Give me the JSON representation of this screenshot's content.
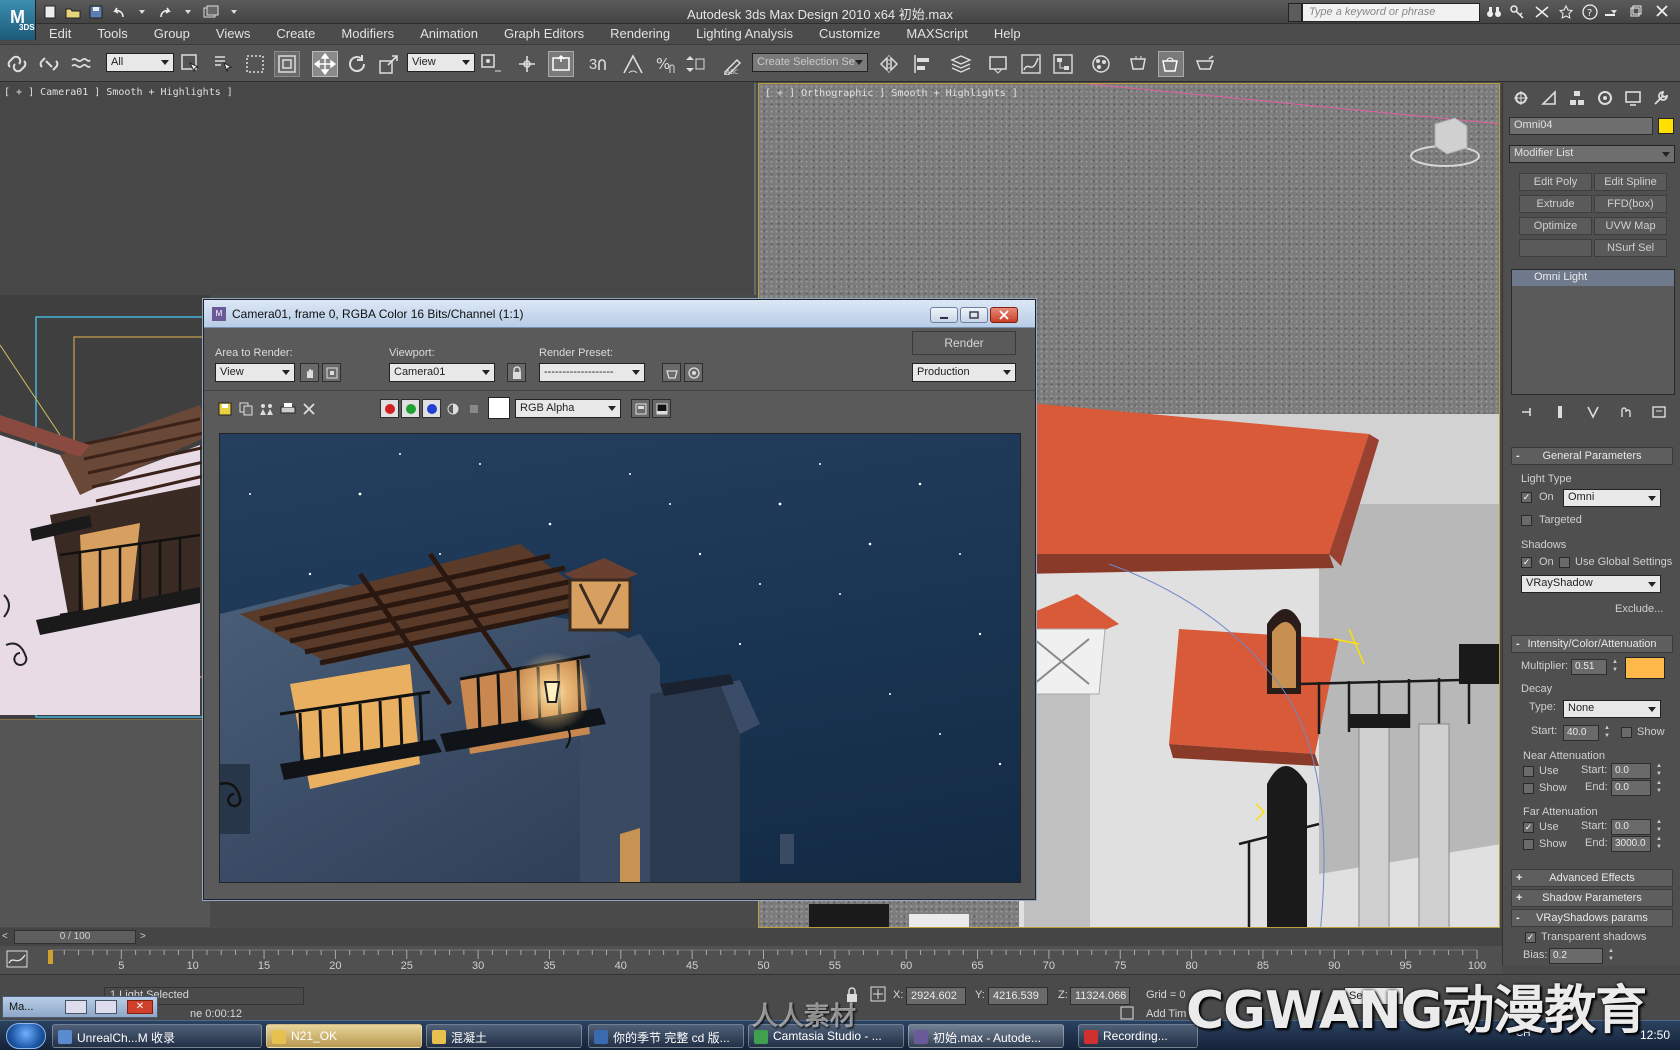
{
  "app": {
    "logo_text": "M",
    "logo_sub": "3DS",
    "window_title": "Autodesk 3ds Max Design 2010 x64       初始.max",
    "search_placeholder": "Type a keyword or phrase"
  },
  "menu": [
    "Edit",
    "Tools",
    "Group",
    "Views",
    "Create",
    "Modifiers",
    "Animation",
    "Graph Editors",
    "Rendering",
    "Lighting Analysis",
    "Customize",
    "MAXScript",
    "Help"
  ],
  "toolbar": {
    "filter_value": "All",
    "refcoord_value": "View",
    "snap_label": "3",
    "selection_set_placeholder": "Create Selection Se"
  },
  "viewports": {
    "camera_label": "[ + ] Camera01 ] Smooth + Highlights ]",
    "ortho_label": "[ + ] Orthographic ] Smooth + Highlights ]"
  },
  "render_window": {
    "title": "Camera01, frame 0, RGBA Color 16 Bits/Channel (1:1)",
    "area_label": "Area to Render:",
    "area_value": "View",
    "viewport_label": "Viewport:",
    "viewport_value": "Camera01",
    "preset_label": "Render Preset:",
    "preset_value": "-------------------",
    "render_button": "Render",
    "mode_value": "Production",
    "channel_value": "RGB Alpha"
  },
  "command_panel": {
    "object_name": "Omni04",
    "modifier_list": "Modifier List",
    "modifier_buttons": [
      "Edit Poly",
      "Edit Spline",
      "Extrude",
      "FFD(box)",
      "Optimize",
      "UVW Map",
      "",
      "NSurf Sel"
    ],
    "stack_item": "Omni Light",
    "general": {
      "title": "General Parameters",
      "light_type_label": "Light Type",
      "on_label": "On",
      "type_value": "Omni",
      "targeted_label": "Targeted",
      "shadows_label": "Shadows",
      "shadow_on_label": "On",
      "global_label": "Use Global Settings",
      "shadow_type": "VRayShadow",
      "exclude_button": "Exclude..."
    },
    "intensity": {
      "title": "Intensity/Color/Attenuation",
      "multiplier_label": "Multiplier:",
      "multiplier_value": "0.51",
      "decay_label": "Decay",
      "type_label": "Type:",
      "type_value": "None",
      "start_label": "Start:",
      "start_value": "40.0",
      "show_label": "Show",
      "near_label": "Near Attenuation",
      "use_label": "Use",
      "near_start_label": "Start:",
      "near_start": "0.0",
      "near_end_label": "End:",
      "near_end": "0.0",
      "near_show_label": "Show",
      "far_label": "Far Attenuation",
      "far_use_label": "Use",
      "far_start_label": "Start:",
      "far_start": "0.0",
      "far_end_label": "End:",
      "far_end": "3000.0",
      "far_show_label": "Show"
    },
    "rollouts": [
      "Advanced Effects",
      "Shadow Parameters",
      "VRayShadows params"
    ],
    "vray": {
      "transparent_label": "Transparent shadows",
      "bias_label": "Bias:",
      "bias_value": "0.2"
    },
    "colors": {
      "object_color": "#ffe000",
      "light_color": "#ffb84a"
    }
  },
  "timeline": {
    "frame_display": "0 / 100",
    "ticks": [
      "5",
      "10",
      "15",
      "20",
      "25",
      "30",
      "35",
      "40",
      "45",
      "50",
      "55",
      "60",
      "65",
      "70",
      "75",
      "80",
      "85",
      "90",
      "95",
      "100"
    ]
  },
  "status": {
    "selection": "1 Light Selected",
    "x_label": "X:",
    "x": "2924.602",
    "y_label": "Y:",
    "y": "4216.539",
    "z_label": "Z:",
    "z": "11324.066",
    "grid": "Grid = 0",
    "add_time_tag": "Add Tim",
    "time_text": "ne  0:00:12",
    "key_label": "Sel"
  },
  "mini_listener": {
    "label": "Ma..."
  },
  "taskbar": {
    "items": [
      "UnrealCh...M 收录",
      "N21_OK",
      "混凝土",
      "你的季节 完整 cd 版...",
      "Camtasia Studio - ...",
      "初始.max - Autode...",
      "Recording..."
    ],
    "clock": "12:50",
    "lang": "CH"
  },
  "watermark": {
    "brand": "CGWANG动漫教育",
    "site": "人人素材"
  }
}
